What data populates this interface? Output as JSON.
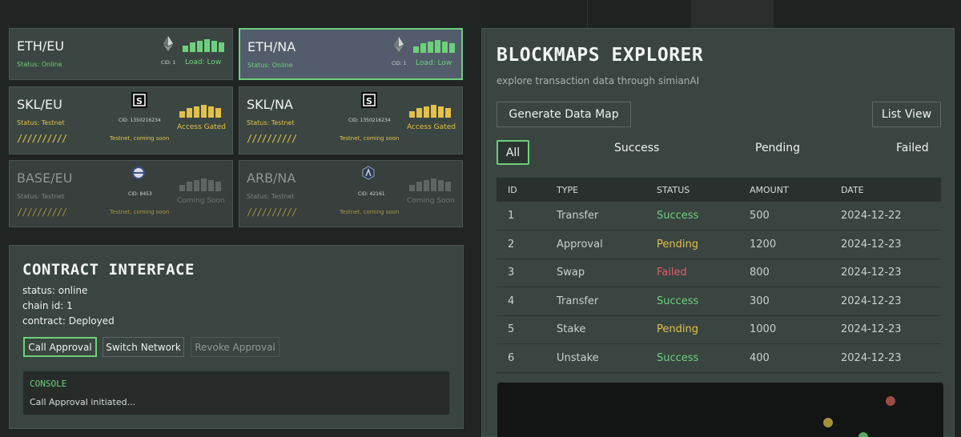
{
  "servers": [
    {
      "name": "ETH/EU",
      "status": "Status: Online",
      "cid": "CID: 1",
      "load": "Load: Low",
      "icon": "ethereum-icon",
      "bar_color": "#6ecf7c"
    },
    {
      "name": "ETH/NA",
      "status": "Status: Online",
      "cid": "CID: 1",
      "load": "Load: Low",
      "icon": "ethereum-icon",
      "bar_color": "#6ecf7c",
      "selected": true
    },
    {
      "name": "SKL/EU",
      "status": "Status: Testnet",
      "cid": "CID: 1350216234",
      "load": "Access Gated",
      "icon": "skale-icon",
      "bar_color": "#e3c048",
      "stripes": "//////////",
      "note": "Testnet, coming soon"
    },
    {
      "name": "SKL/NA",
      "status": "Status: Testnet",
      "cid": "CID: 1350216234",
      "load": "Access Gated",
      "icon": "skale-icon",
      "bar_color": "#e3c048",
      "stripes": "//////////",
      "note": "Testnet, coming soon"
    },
    {
      "name": "BASE/EU",
      "status": "Status: Testnet",
      "cid": "CID: 8453",
      "load": "Coming Soon",
      "icon": "base-icon",
      "bar_color": "#5e6663",
      "stripes": "//////////",
      "note": "Testnet, coming soon"
    },
    {
      "name": "ARB/NA",
      "status": "Status: Testnet",
      "cid": "CID: 42161",
      "load": "Coming Soon",
      "icon": "arbitrum-icon",
      "bar_color": "#5e6663",
      "stripes": "//////////",
      "note": "Testnet, coming soon"
    }
  ],
  "contract": {
    "title": "CONTRACT INTERFACE",
    "status": "status: online",
    "chain_id": "chain id: 1",
    "contract": "contract: Deployed",
    "buttons": {
      "call": "Call Approval",
      "switch": "Switch Network",
      "revoke": "Revoke Approval"
    },
    "console_title": "CONSOLE",
    "console_msg": "Call Approval initiated..."
  },
  "explorer": {
    "title": "BLOCKMAPS EXPLORER",
    "subtitle": "explore transaction data through simianAI",
    "generate_label": "Generate Data Map",
    "list_view_label": "List View",
    "filters": {
      "all": "All",
      "success": "Success",
      "pending": "Pending",
      "failed": "Failed"
    },
    "columns": [
      "ID",
      "TYPE",
      "STATUS",
      "AMOUNT",
      "DATE"
    ],
    "rows": [
      {
        "id": "1",
        "type": "Transfer",
        "status": "Success",
        "amount": "500",
        "date": "2024-12-22"
      },
      {
        "id": "2",
        "type": "Approval",
        "status": "Pending",
        "amount": "1200",
        "date": "2024-12-23"
      },
      {
        "id": "3",
        "type": "Swap",
        "status": "Failed",
        "amount": "800",
        "date": "2024-12-23"
      },
      {
        "id": "4",
        "type": "Transfer",
        "status": "Success",
        "amount": "300",
        "date": "2024-12-23"
      },
      {
        "id": "5",
        "type": "Stake",
        "status": "Pending",
        "amount": "1000",
        "date": "2024-12-23"
      },
      {
        "id": "6",
        "type": "Unstake",
        "status": "Success",
        "amount": "400",
        "date": "2024-12-23"
      }
    ]
  },
  "colors": {
    "accent": "#6ecf7c",
    "warning": "#e3c048",
    "danger": "#e06060"
  }
}
